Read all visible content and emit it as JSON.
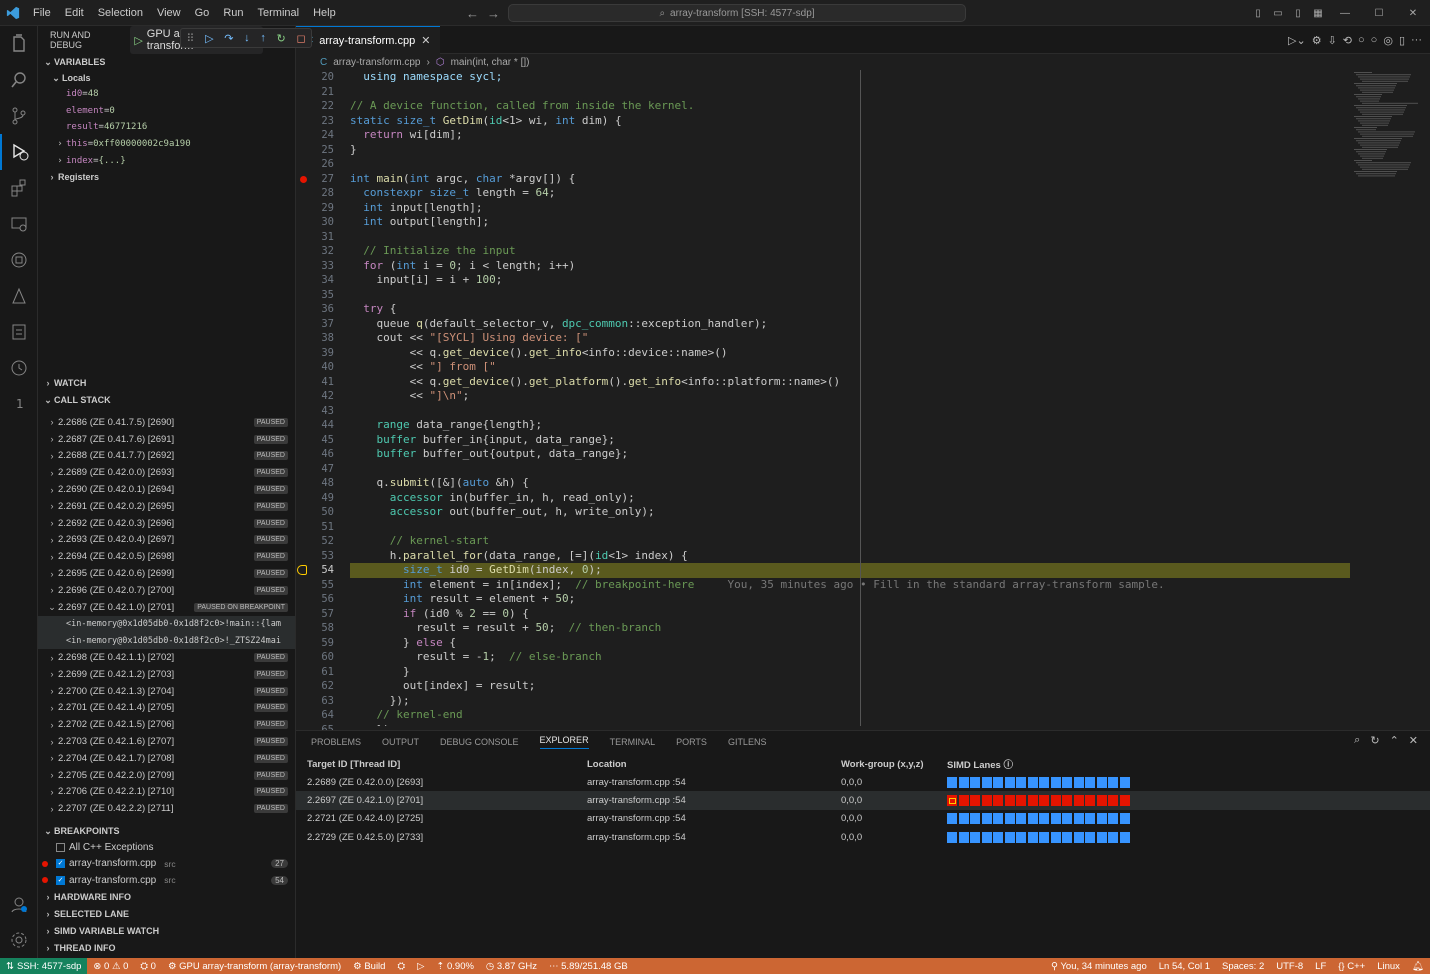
{
  "menu": [
    "File",
    "Edit",
    "Selection",
    "View",
    "Go",
    "Run",
    "Terminal",
    "Help"
  ],
  "command_center": "array-transform [SSH: 4577-sdp]",
  "run_debug": {
    "title": "RUN AND DEBUG",
    "config": "GPU array-transform"
  },
  "variables": {
    "title": "VARIABLES",
    "locals": "Locals",
    "items": [
      {
        "name": "id0",
        "value": "48",
        "expandable": false
      },
      {
        "name": "element",
        "value": "0",
        "expandable": false
      },
      {
        "name": "result",
        "value": "46771216",
        "expandable": false
      },
      {
        "name": "this",
        "value": "0xff00000002c9a190",
        "expandable": true
      },
      {
        "name": "index",
        "value": "{...}",
        "expandable": true
      }
    ],
    "registers": "Registers"
  },
  "watch": "WATCH",
  "callstack": {
    "title": "CALL STACK",
    "rows": [
      {
        "t": "2.2686 (ZE 0.41.7.5) [2690]",
        "b": "PAUSED"
      },
      {
        "t": "2.2687 (ZE 0.41.7.6) [2691]",
        "b": "PAUSED"
      },
      {
        "t": "2.2688 (ZE 0.41.7.7) [2692]",
        "b": "PAUSED"
      },
      {
        "t": "2.2689 (ZE 0.42.0.0) [2693]",
        "b": "PAUSED"
      },
      {
        "t": "2.2690 (ZE 0.42.0.1) [2694]",
        "b": "PAUSED"
      },
      {
        "t": "2.2691 (ZE 0.42.0.2) [2695]",
        "b": "PAUSED"
      },
      {
        "t": "2.2692 (ZE 0.42.0.3) [2696]",
        "b": "PAUSED"
      },
      {
        "t": "2.2693 (ZE 0.42.0.4) [2697]",
        "b": "PAUSED"
      },
      {
        "t": "2.2694 (ZE 0.42.0.5) [2698]",
        "b": "PAUSED"
      },
      {
        "t": "2.2695 (ZE 0.42.0.6) [2699]",
        "b": "PAUSED"
      },
      {
        "t": "2.2696 (ZE 0.42.0.7) [2700]",
        "b": "PAUSED"
      },
      {
        "t": "2.2697 (ZE 0.42.1.0) [2701]",
        "b": "PAUSED ON BREAKPOINT",
        "open": true
      },
      {
        "t": "<in-memory@0x1d05db0-0x1d8f2c0>!main::{lam",
        "frame": true
      },
      {
        "t": "<in-memory@0x1d05db0-0x1d8f2c0>!_ZTSZ24mai",
        "frame": true
      },
      {
        "t": "2.2698 (ZE 0.42.1.1) [2702]",
        "b": "PAUSED"
      },
      {
        "t": "2.2699 (ZE 0.42.1.2) [2703]",
        "b": "PAUSED"
      },
      {
        "t": "2.2700 (ZE 0.42.1.3) [2704]",
        "b": "PAUSED"
      },
      {
        "t": "2.2701 (ZE 0.42.1.4) [2705]",
        "b": "PAUSED"
      },
      {
        "t": "2.2702 (ZE 0.42.1.5) [2706]",
        "b": "PAUSED"
      },
      {
        "t": "2.2703 (ZE 0.42.1.6) [2707]",
        "b": "PAUSED"
      },
      {
        "t": "2.2704 (ZE 0.42.1.7) [2708]",
        "b": "PAUSED"
      },
      {
        "t": "2.2705 (ZE 0.42.2.0) [2709]",
        "b": "PAUSED"
      },
      {
        "t": "2.2706 (ZE 0.42.2.1) [2710]",
        "b": "PAUSED"
      },
      {
        "t": "2.2707 (ZE 0.42.2.2) [2711]",
        "b": "PAUSED"
      }
    ]
  },
  "breakpoints": {
    "title": "BREAKPOINTS",
    "all": "All C++ Exceptions",
    "items": [
      {
        "file": "array-transform.cpp",
        "dir": "src",
        "line": "27"
      },
      {
        "file": "array-transform.cpp",
        "dir": "src",
        "line": "54"
      }
    ]
  },
  "more_sections": [
    "HARDWARE INFO",
    "SELECTED LANE",
    "SIMD VARIABLE WATCH",
    "THREAD INFO"
  ],
  "tab": {
    "name": "array-transform.cpp"
  },
  "breadcrumb": {
    "file": "array-transform.cpp",
    "symbol": "main(int, char * [])"
  },
  "code": {
    "start": 20,
    "current": 54,
    "breakpoints": [
      27
    ],
    "lines": [
      [
        [
          "  ",
          ""
        ],
        [
          "using namespace sycl;",
          "vr"
        ]
      ],
      [],
      [
        [
          "// A device function, called from inside the kernel.",
          "cm"
        ]
      ],
      [
        [
          "static size_t ",
          "kw"
        ],
        [
          "GetDim",
          "fn"
        ],
        [
          "(",
          ""
        ],
        [
          "id",
          "ty"
        ],
        [
          "<1> ",
          ""
        ],
        [
          "wi",
          ""
        ],
        [
          ", ",
          ""
        ],
        [
          "int ",
          "kw"
        ],
        [
          "dim",
          ""
        ],
        [
          ") {",
          ""
        ]
      ],
      [
        [
          "  ",
          ""
        ],
        [
          "return ",
          "ct"
        ],
        [
          "wi[dim];",
          ""
        ]
      ],
      [
        [
          "}",
          ""
        ]
      ],
      [],
      [
        [
          "int ",
          "kw"
        ],
        [
          "main",
          "fn"
        ],
        [
          "(",
          ""
        ],
        [
          "int ",
          "kw"
        ],
        [
          "argc, ",
          ""
        ],
        [
          "char ",
          "kw"
        ],
        [
          "*argv[]) {",
          ""
        ]
      ],
      [
        [
          "  ",
          ""
        ],
        [
          "constexpr size_t ",
          "kw"
        ],
        [
          "length = ",
          ""
        ],
        [
          "64",
          "num"
        ],
        [
          ";",
          ""
        ]
      ],
      [
        [
          "  ",
          ""
        ],
        [
          "int ",
          "kw"
        ],
        [
          "input[length];",
          ""
        ]
      ],
      [
        [
          "  ",
          ""
        ],
        [
          "int ",
          "kw"
        ],
        [
          "output[length];",
          ""
        ]
      ],
      [],
      [
        [
          "  ",
          ""
        ],
        [
          "// Initialize the input",
          "cm"
        ]
      ],
      [
        [
          "  ",
          ""
        ],
        [
          "for ",
          "ct"
        ],
        [
          "(",
          ""
        ],
        [
          "int ",
          "kw"
        ],
        [
          "i = ",
          ""
        ],
        [
          "0",
          "num"
        ],
        [
          "; i < length; i++)",
          ""
        ]
      ],
      [
        [
          "    ",
          ""
        ],
        [
          "input[i] = i + ",
          ""
        ],
        [
          "100",
          "num"
        ],
        [
          ";",
          ""
        ]
      ],
      [],
      [
        [
          "  ",
          ""
        ],
        [
          "try ",
          "ct"
        ],
        [
          "{",
          ""
        ]
      ],
      [
        [
          "    queue ",
          ""
        ],
        [
          "q",
          "fn"
        ],
        [
          "(default_selector_v, ",
          ""
        ],
        [
          "dpc_common",
          "ty"
        ],
        [
          "::exception_handler);",
          ""
        ]
      ],
      [
        [
          "    cout << ",
          ""
        ],
        [
          "\"[SYCL] Using device: [\"",
          "str"
        ]
      ],
      [
        [
          "         << q.",
          ""
        ],
        [
          "get_device",
          "fn"
        ],
        [
          "().",
          ""
        ],
        [
          "get_info",
          "fn"
        ],
        [
          "<info::device::name>()",
          ""
        ]
      ],
      [
        [
          "         << ",
          ""
        ],
        [
          "\"] from [\"",
          "str"
        ]
      ],
      [
        [
          "         << q.",
          ""
        ],
        [
          "get_device",
          "fn"
        ],
        [
          "().",
          ""
        ],
        [
          "get_platform",
          "fn"
        ],
        [
          "().",
          ""
        ],
        [
          "get_info",
          "fn"
        ],
        [
          "<info::platform::name>()",
          ""
        ]
      ],
      [
        [
          "         << ",
          ""
        ],
        [
          "\"]\\n\"",
          "str"
        ],
        [
          ";",
          ""
        ]
      ],
      [],
      [
        [
          "    ",
          ""
        ],
        [
          "range ",
          "ty"
        ],
        [
          "data_range{length};",
          ""
        ]
      ],
      [
        [
          "    ",
          ""
        ],
        [
          "buffer ",
          "ty"
        ],
        [
          "buffer_in{input, data_range};",
          ""
        ]
      ],
      [
        [
          "    ",
          ""
        ],
        [
          "buffer ",
          "ty"
        ],
        [
          "buffer_out{output, data_range};",
          ""
        ]
      ],
      [],
      [
        [
          "    q.",
          ""
        ],
        [
          "submit",
          "fn"
        ],
        [
          "([&](",
          ""
        ],
        [
          "auto ",
          "kw"
        ],
        [
          "&h) {",
          ""
        ]
      ],
      [
        [
          "      ",
          ""
        ],
        [
          "accessor ",
          "ty"
        ],
        [
          "in(buffer_in, h, read_only);",
          ""
        ]
      ],
      [
        [
          "      ",
          ""
        ],
        [
          "accessor ",
          "ty"
        ],
        [
          "out(buffer_out, h, write_only);",
          ""
        ]
      ],
      [],
      [
        [
          "      ",
          ""
        ],
        [
          "// kernel-start",
          "cm"
        ]
      ],
      [
        [
          "      h.",
          ""
        ],
        [
          "parallel_for",
          "fn"
        ],
        [
          "(data_range, [=](",
          ""
        ],
        [
          "id",
          "ty"
        ],
        [
          "<1> index) {",
          ""
        ]
      ],
      [
        [
          "        ",
          ""
        ],
        [
          "size_t ",
          "kw"
        ],
        [
          "id0 = ",
          ""
        ],
        [
          "GetDim",
          "fn"
        ],
        [
          "(index, ",
          ""
        ],
        [
          "0",
          "num"
        ],
        [
          ");",
          ""
        ]
      ],
      [
        [
          "        ",
          ""
        ],
        [
          "int ",
          "kw"
        ],
        [
          "element = in[index];  ",
          ""
        ],
        [
          "// breakpoint-here",
          "cm"
        ],
        [
          "     You, 35 minutes ago • Fill in the standard array-transform sample.",
          "blame"
        ]
      ],
      [
        [
          "        ",
          ""
        ],
        [
          "int ",
          "kw"
        ],
        [
          "result = element + ",
          ""
        ],
        [
          "50",
          "num"
        ],
        [
          ";",
          ""
        ]
      ],
      [
        [
          "        ",
          ""
        ],
        [
          "if ",
          "ct"
        ],
        [
          "(id0 % ",
          ""
        ],
        [
          "2 ",
          "num"
        ],
        [
          "== ",
          ""
        ],
        [
          "0",
          "num"
        ],
        [
          ") {",
          ""
        ]
      ],
      [
        [
          "          result = result + ",
          ""
        ],
        [
          "50",
          "num"
        ],
        [
          ";  ",
          ""
        ],
        [
          "// then-branch",
          "cm"
        ]
      ],
      [
        [
          "        } ",
          ""
        ],
        [
          "else ",
          "ct"
        ],
        [
          "{",
          ""
        ]
      ],
      [
        [
          "          result = -",
          ""
        ],
        [
          "1",
          "num"
        ],
        [
          ";  ",
          ""
        ],
        [
          "// else-branch",
          "cm"
        ]
      ],
      [
        [
          "        }",
          ""
        ]
      ],
      [
        [
          "        out[index] = result;",
          ""
        ]
      ],
      [
        [
          "      });",
          ""
        ]
      ],
      [
        [
          "    ",
          ""
        ],
        [
          "// kernel-end",
          "cm"
        ]
      ],
      [
        [
          "    });",
          ""
        ]
      ]
    ]
  },
  "panel": {
    "tabs": [
      "PROBLEMS",
      "OUTPUT",
      "DEBUG CONSOLE",
      "EXPLORER",
      "TERMINAL",
      "PORTS",
      "GITLENS"
    ],
    "active": "EXPLORER",
    "headers": [
      "Target ID [Thread ID]",
      "Location",
      "Work-group (x,y,z)",
      "SIMD Lanes ⓘ"
    ],
    "rows": [
      {
        "id": "2.2689 (ZE 0.42.0.0) [2693]",
        "loc": "array-transform.cpp :54",
        "wg": "0,0,0",
        "lanes": "blue"
      },
      {
        "id": "2.2697 (ZE 0.42.1.0) [2701]",
        "loc": "array-transform.cpp :54",
        "wg": "0,0,0",
        "lanes": "red"
      },
      {
        "id": "2.2721 (ZE 0.42.4.0) [2725]",
        "loc": "array-transform.cpp :54",
        "wg": "0,0,0",
        "lanes": "blue"
      },
      {
        "id": "2.2729 (ZE 0.42.5.0) [2733]",
        "loc": "array-transform.cpp :54",
        "wg": "0,0,0",
        "lanes": "blue"
      }
    ],
    "lane_count": 16
  },
  "status": {
    "remote": "SSH: 4577-sdp",
    "errors": "0",
    "warnings": "0",
    "ports": "0",
    "debug": "GPU array-transform (array-transform)",
    "build": "Build",
    "cpu": "0.90%",
    "freq": "3.87 GHz",
    "mem": "5.89/251.48 GB",
    "blame": "You, 34 minutes ago",
    "pos": "Ln 54, Col 1",
    "spaces": "Spaces: 2",
    "enc": "UTF-8",
    "eol": "LF",
    "lang": "C++",
    "os": "Linux"
  },
  "colors": {
    "status_bg": "#cc6633",
    "remote_bg": "#16825d",
    "accent": "#0078d4",
    "lane_blue": "#3794ff",
    "lane_red": "#e51400"
  }
}
